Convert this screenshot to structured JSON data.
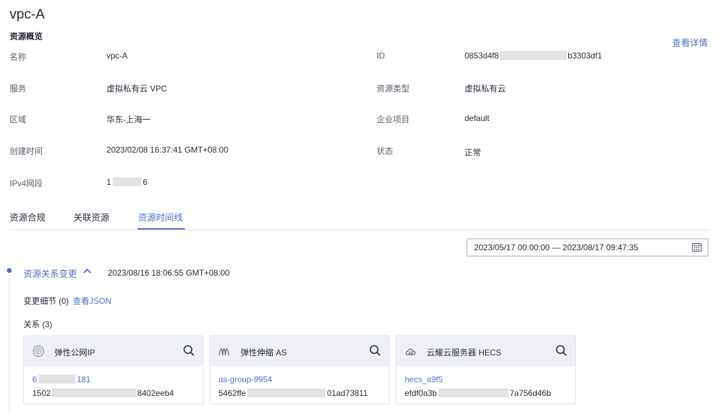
{
  "page": {
    "title": "vpc-A"
  },
  "overview": {
    "heading": "资源概览",
    "detail_link": "查看详情",
    "rows": [
      {
        "label": "名称",
        "value": "vpc-A"
      },
      {
        "label": "ID",
        "value_prefix": "0853d4f8",
        "value_suffix": "b3303df1"
      },
      {
        "label": "服务",
        "value": "虚拟私有云 VPC"
      },
      {
        "label": "资源类型",
        "value": "虚拟私有云"
      },
      {
        "label": "区域",
        "value": "华东-上海一"
      },
      {
        "label": "企业项目",
        "value": "default"
      },
      {
        "label": "创建时间",
        "value": "2023/02/08 16:37:41 GMT+08:00"
      },
      {
        "label": "状态",
        "value": "正常"
      },
      {
        "label": "IPv4网段",
        "value_prefix": "1",
        "value_suffix": "6"
      }
    ]
  },
  "tabs": [
    {
      "label": "资源合规",
      "active": false
    },
    {
      "label": "关联资源",
      "active": false
    },
    {
      "label": "资源时间线",
      "active": true
    }
  ],
  "date_range": {
    "value": "2023/05/17 00:00:00 — 2023/08/17 09:47:35",
    "icon": "calendar-icon"
  },
  "timeline": {
    "event_title": "资源关系变更",
    "event_time": "2023/08/16 18:06:55 GMT+08:00",
    "change_label": "变更细节 (0)",
    "json_link": "查看JSON",
    "relations_label": "关系 (3)",
    "cards": [
      {
        "icon": "eip-icon",
        "title": "弹性公网IP",
        "name_prefix": "6",
        "name_suffix": "181",
        "id_prefix": "1502",
        "id_suffix": "8402eeb4"
      },
      {
        "icon": "auto-scaling-icon",
        "title": "弹性伸缩 AS",
        "name": "as-group-9954",
        "id_prefix": "5462ffe",
        "id_suffix": "01ad73811"
      },
      {
        "icon": "cloud-server-icon",
        "title": "云耀云服务器 HECS",
        "name": "hecs_a9f5",
        "id_prefix": "efdf0a3b",
        "id_suffix": "7a756d46b"
      }
    ]
  },
  "colors": {
    "accent": "#526ecc",
    "text": "#252b3a",
    "label": "#575d6c",
    "border": "#dfe1e6",
    "card_header": "#eef0f5"
  }
}
